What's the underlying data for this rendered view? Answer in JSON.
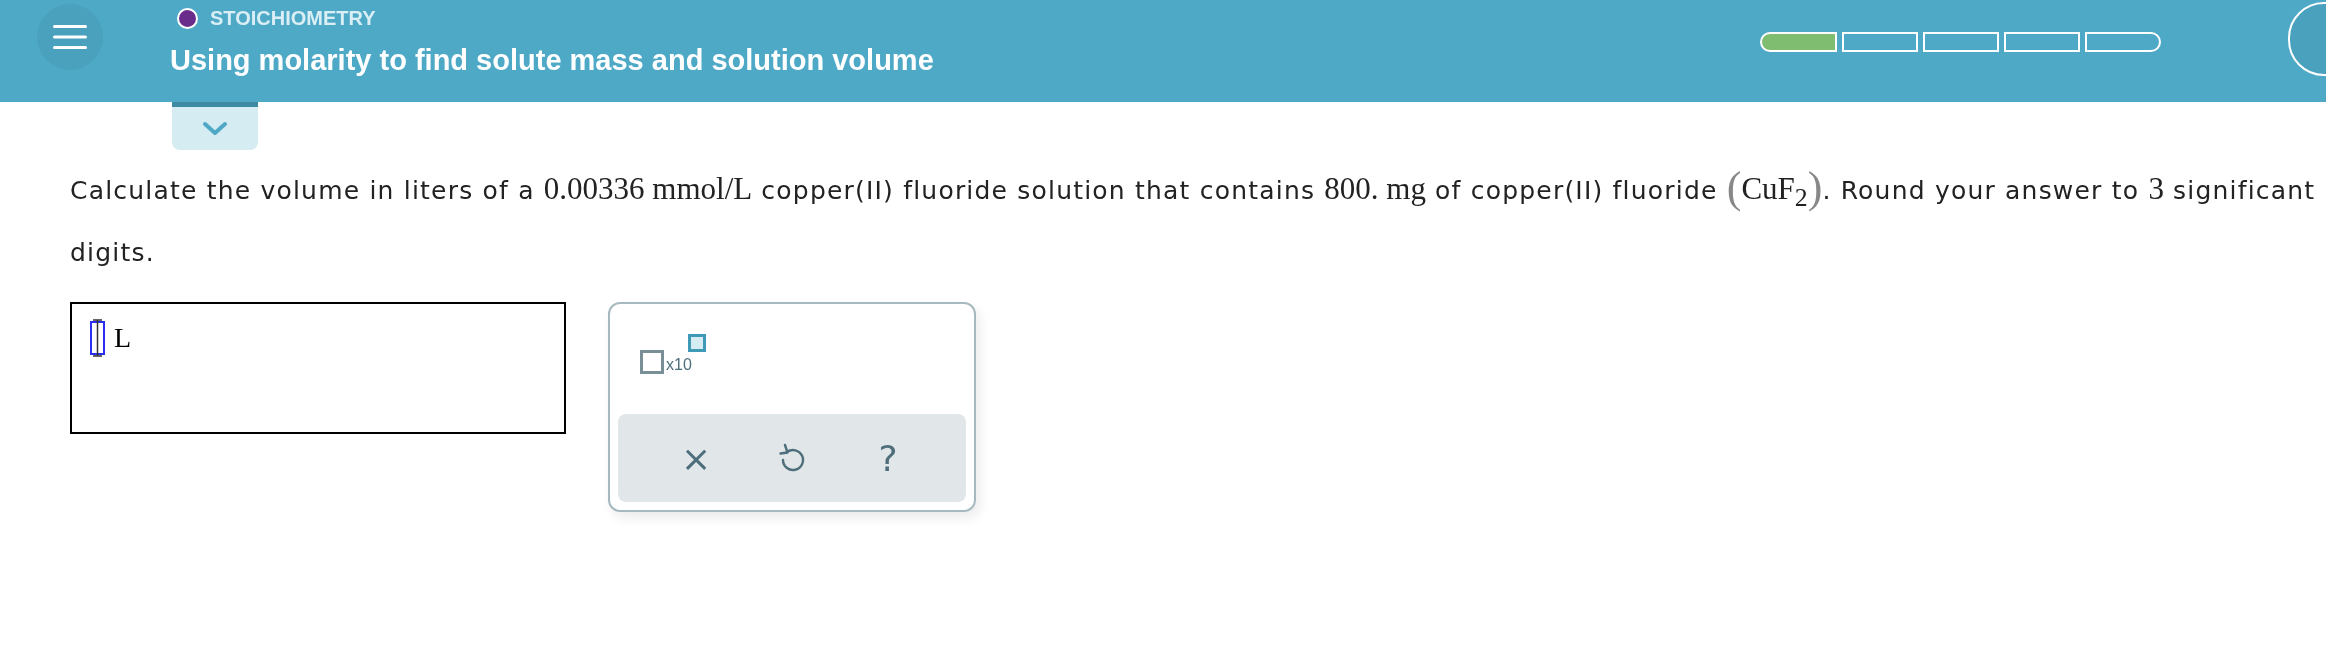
{
  "header": {
    "category": "STOICHIOMETRY",
    "title": "Using molarity to find solute mass and solution volume",
    "progress": [
      {
        "filled": true
      },
      {
        "filled": false
      },
      {
        "filled": false
      },
      {
        "filled": false
      },
      {
        "filled": false
      }
    ]
  },
  "question": {
    "segments": [
      {
        "kind": "text",
        "text": "Calculate the volume in liters of a "
      },
      {
        "kind": "math",
        "text": "0.00336"
      },
      {
        "kind": "math",
        "text": " mmol/L"
      },
      {
        "kind": "text",
        "text": " copper(II) fluoride solution that contains "
      },
      {
        "kind": "math",
        "text": "800."
      },
      {
        "kind": "math",
        "text": " mg"
      },
      {
        "kind": "text",
        "text": " of copper(II) fluoride "
      },
      {
        "kind": "paren",
        "text": "("
      },
      {
        "kind": "math",
        "text": "CuF$_{2}$"
      },
      {
        "kind": "paren",
        "text": ")"
      },
      {
        "kind": "text",
        "text": ". Round your answer to "
      },
      {
        "kind": "math",
        "text": "3"
      },
      {
        "kind": "text",
        "text": " significant digits."
      }
    ]
  },
  "answer": {
    "unit": "L"
  },
  "keypad": {
    "exponent_label": "x10",
    "buttons": [
      {
        "kind": "clear",
        "label": "×"
      },
      {
        "kind": "undo"
      },
      {
        "kind": "help",
        "label": "?"
      }
    ]
  }
}
